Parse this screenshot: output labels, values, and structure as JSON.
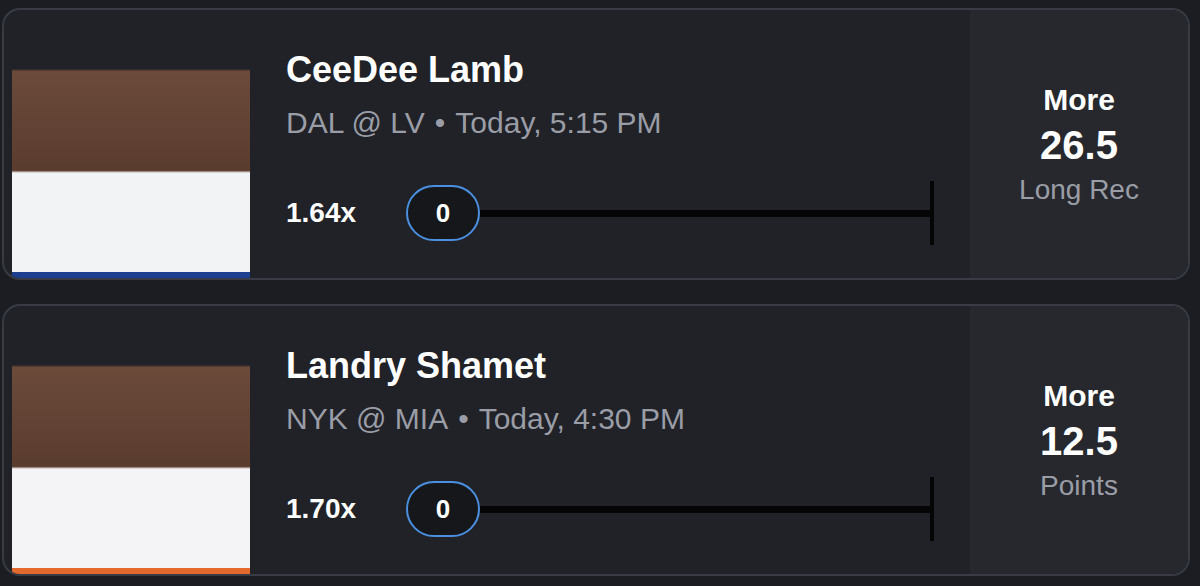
{
  "picks": [
    {
      "player": "CeeDee Lamb",
      "matchup": "DAL @ LV",
      "separator": "•",
      "time": "Today, 5:15 PM",
      "multiplier": "1.64x",
      "progress": "0",
      "level": 0,
      "direction": "More",
      "line": "26.5",
      "stat": "Long Rec",
      "jersey_color": "#f2f3f5",
      "accent_color": "#1d3f8f"
    },
    {
      "player": "Landry Shamet",
      "matchup": "NYK @ MIA",
      "separator": "•",
      "time": "Today, 4:30 PM",
      "multiplier": "1.70x",
      "progress": "0",
      "level": 0,
      "direction": "More",
      "line": "12.5",
      "stat": "Points",
      "jersey_color": "#f4f4f6",
      "accent_color": "#e36a2c"
    }
  ]
}
